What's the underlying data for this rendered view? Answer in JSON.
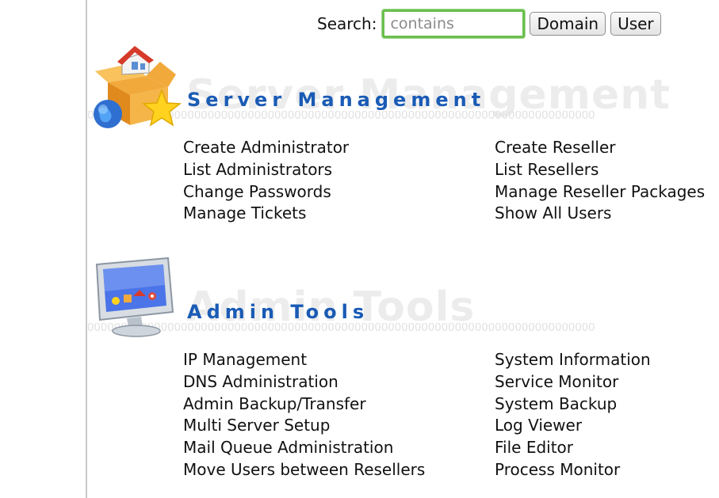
{
  "search": {
    "label": "Search:",
    "placeholder": "contains",
    "domain_button": "Domain",
    "user_button": "User"
  },
  "server_management": {
    "title": "Server Management",
    "watermark": "Server Management",
    "icon": "house-box-globe-star-icon",
    "left_links": [
      "Create Administrator",
      "List Administrators",
      "Change Passwords",
      "Manage Tickets"
    ],
    "right_links": [
      "Create Reseller",
      "List Resellers",
      "Manage Reseller Packages",
      "Show All Users"
    ]
  },
  "admin_tools": {
    "title": "Admin Tools",
    "watermark": "Admin Tools",
    "icon": "monitor-icon",
    "left_links": [
      "IP Management",
      "DNS Administration",
      "Admin Backup/Transfer",
      "Multi Server Setup",
      "Mail Queue Administration",
      "Move Users between Resellers"
    ],
    "right_links": [
      "System Information",
      "Service Monitor",
      "System Backup",
      "Log Viewer",
      "File Editor",
      "Process Monitor"
    ]
  },
  "colors": {
    "title_blue": "#1a5bb5",
    "search_focus_green": "#6bbf4d"
  }
}
